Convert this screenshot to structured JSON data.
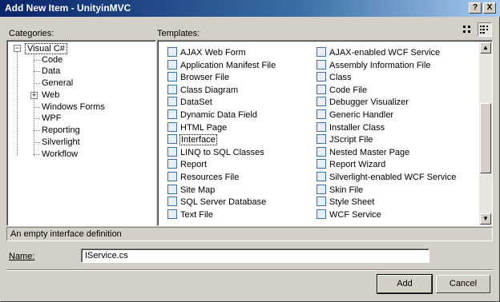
{
  "window": {
    "title": "Add New Item - UnityinMVC",
    "help_label": "?",
    "close_label": "X"
  },
  "categories_label": "Categories:",
  "templates_label": "Templates:",
  "categories": {
    "root": "Visual C#",
    "children": [
      "Code",
      "Data",
      "General",
      "Web",
      "Windows Forms",
      "WPF",
      "Reporting",
      "Silverlight",
      "Workflow"
    ]
  },
  "templates": {
    "col1": [
      "AJAX Web Form",
      "Application Manifest File",
      "Browser File",
      "Class Diagram",
      "DataSet",
      "Dynamic Data Field",
      "HTML Page",
      "Interface",
      "LINQ to SQL Classes",
      "Report",
      "Resources File",
      "Site Map",
      "SQL Server Database",
      "Text File"
    ],
    "col2": [
      "AJAX-enabled WCF Service",
      "Assembly Information File",
      "Class",
      "Code File",
      "Debugger Visualizer",
      "Generic Handler",
      "Installer Class",
      "JScript File",
      "Nested Master Page",
      "Report Wizard",
      "Silverlight-enabled WCF Service",
      "Skin File",
      "Style Sheet",
      "WCF Service"
    ],
    "selected": "Interface"
  },
  "description": "An empty interface definition",
  "name_label": "Name:",
  "name_value": "IService.cs",
  "buttons": {
    "add": "Add",
    "cancel": "Cancel"
  }
}
